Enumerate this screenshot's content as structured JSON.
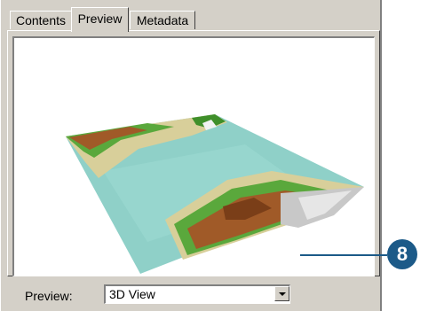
{
  "tabs": [
    {
      "label": "Contents",
      "active": false
    },
    {
      "label": "Preview",
      "active": true
    },
    {
      "label": "Metadata",
      "active": false
    }
  ],
  "preview": {
    "label": "Preview:",
    "selected_view": "3D View"
  },
  "callout": {
    "number": "8",
    "color": "#1c5a88"
  },
  "colors": {
    "dialog_face": "#d4d0c8",
    "water": "#8fd0c8",
    "sand": "#d8cf9a",
    "lowland": "#5aa83c",
    "highland": "#a05a28",
    "peak": "#c8c8c8"
  }
}
